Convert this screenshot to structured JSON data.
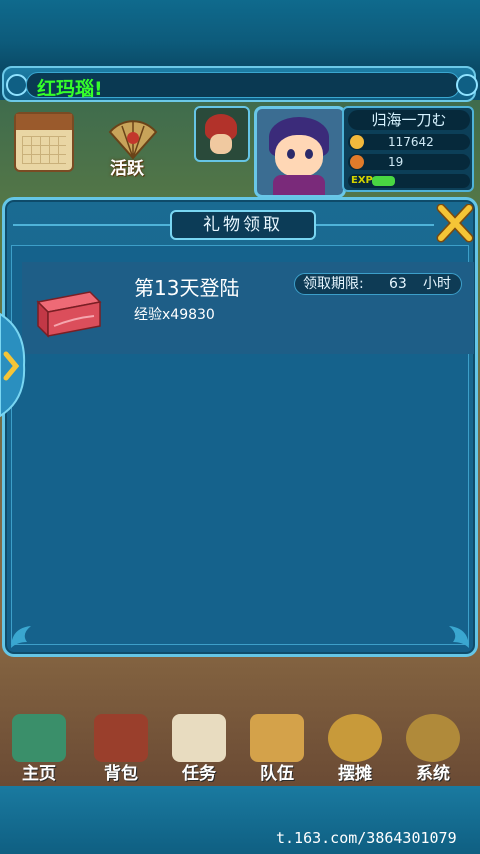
{
  "notice": {
    "text": "红玛瑙!"
  },
  "hud": {
    "activity_label": "活跃",
    "player_name": "归海一刀む",
    "silver": "117642",
    "gold": "19",
    "exp_label": "EXP",
    "exp_progress": 0.24
  },
  "dialog": {
    "title": "礼物领取",
    "gift": {
      "title": "第13天登陆",
      "reward": "经验x49830",
      "deadline_label": "领取期限:",
      "deadline_value": "63",
      "deadline_unit": "小时"
    }
  },
  "bottom_nav": [
    {
      "label": "主页",
      "icon": "home-icon"
    },
    {
      "label": "背包",
      "icon": "backpack-icon"
    },
    {
      "label": "任务",
      "icon": "quest-scroll-icon"
    },
    {
      "label": "队伍",
      "icon": "team-icon"
    },
    {
      "label": "摆摊",
      "icon": "stall-icon"
    },
    {
      "label": "系统",
      "icon": "settings-icon"
    }
  ],
  "watermark": "t.163.com/3864301079",
  "colors": {
    "panel_blue": "#17668e",
    "border_cyan": "#65c6e6",
    "notice_green": "#35ff2a",
    "close_gold": "#f5c536"
  }
}
